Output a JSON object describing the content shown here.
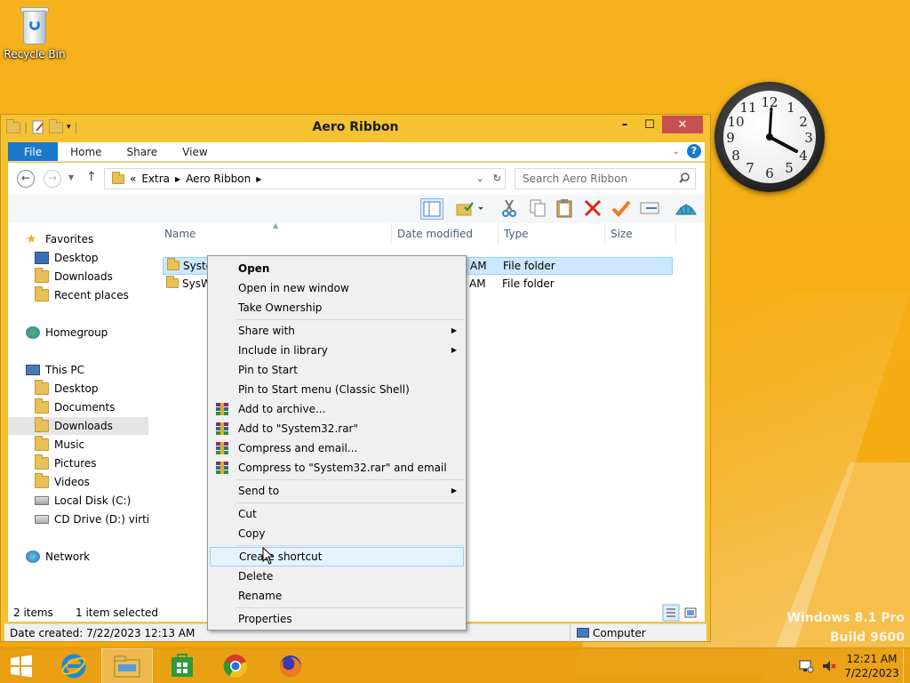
{
  "desktop": {
    "recycle_bin_label": "Recycle Bin",
    "watermark_line1": "Windows 8.1 Pro",
    "watermark_line2": "Build 9600"
  },
  "clock_gadget": {
    "numbers": [
      "12",
      "1",
      "2",
      "3",
      "4",
      "5",
      "6",
      "7",
      "8",
      "9",
      "10",
      "11"
    ]
  },
  "window": {
    "title": "Aero Ribbon",
    "minimize": "–",
    "maximize": "☐",
    "close": "✕",
    "ribbon_tabs": [
      "File",
      "Home",
      "Share",
      "View"
    ],
    "help": "?",
    "address": {
      "prefix": "«",
      "crumbs": [
        "Extra",
        "Aero Ribbon"
      ]
    },
    "search_placeholder": "Search Aero Ribbon"
  },
  "navpane": {
    "items": [
      {
        "label": "Favorites",
        "icon": "star-icon"
      },
      {
        "label": "Desktop",
        "icon": "desktop-icon"
      },
      {
        "label": "Downloads",
        "icon": "downloads-icon"
      },
      {
        "label": "Recent places",
        "icon": "recent-icon"
      },
      {
        "label": "Homegroup",
        "icon": "homegroup-icon"
      },
      {
        "label": "This PC",
        "icon": "computer-icon"
      },
      {
        "label": "Desktop",
        "icon": "folder-icon"
      },
      {
        "label": "Documents",
        "icon": "folder-icon"
      },
      {
        "label": "Downloads",
        "icon": "folder-icon"
      },
      {
        "label": "Music",
        "icon": "folder-icon"
      },
      {
        "label": "Pictures",
        "icon": "folder-icon"
      },
      {
        "label": "Videos",
        "icon": "folder-icon"
      },
      {
        "label": "Local Disk (C:)",
        "icon": "disk-icon"
      },
      {
        "label": "CD Drive (D:) virtio-v",
        "icon": "cd-icon"
      },
      {
        "label": "Network",
        "icon": "network-icon"
      }
    ]
  },
  "filelist": {
    "columns": [
      "Name",
      "Date modified",
      "Type",
      "Size"
    ],
    "rows": [
      {
        "name": "Syste",
        "date": "AM",
        "type": "File folder"
      },
      {
        "name": "SysW",
        "date": "AM",
        "type": "File folder"
      }
    ]
  },
  "status": {
    "items_count": "2 items",
    "selected": "1 item selected",
    "detail": "Date created: 7/22/2023 12:13 AM",
    "location": "Computer"
  },
  "context_menu": {
    "items": [
      {
        "label": "Open",
        "bold": true
      },
      {
        "label": "Open in new window"
      },
      {
        "label": "Take Ownership"
      },
      {
        "label": "Share with",
        "submenu": true
      },
      {
        "label": "Include in library",
        "submenu": true
      },
      {
        "label": "Pin to Start"
      },
      {
        "label": "Pin to Start menu (Classic Shell)"
      },
      {
        "label": "Add to archive...",
        "icon": "winrar-icon"
      },
      {
        "label": "Add to \"System32.rar\"",
        "icon": "winrar-icon"
      },
      {
        "label": "Compress and email...",
        "icon": "winrar-icon"
      },
      {
        "label": "Compress to \"System32.rar\" and email",
        "icon": "winrar-icon"
      },
      {
        "label": "Send to",
        "submenu": true
      },
      {
        "label": "Cut"
      },
      {
        "label": "Copy"
      },
      {
        "label": "Create shortcut",
        "hover": true
      },
      {
        "label": "Delete"
      },
      {
        "label": "Rename"
      },
      {
        "label": "Properties"
      }
    ]
  },
  "taskbar": {
    "apps": [
      "start-icon",
      "internet-explorer-icon",
      "file-explorer-icon",
      "store-icon",
      "chrome-icon",
      "firefox-icon"
    ],
    "time": "12:21 AM",
    "date": "7/22/2023"
  }
}
